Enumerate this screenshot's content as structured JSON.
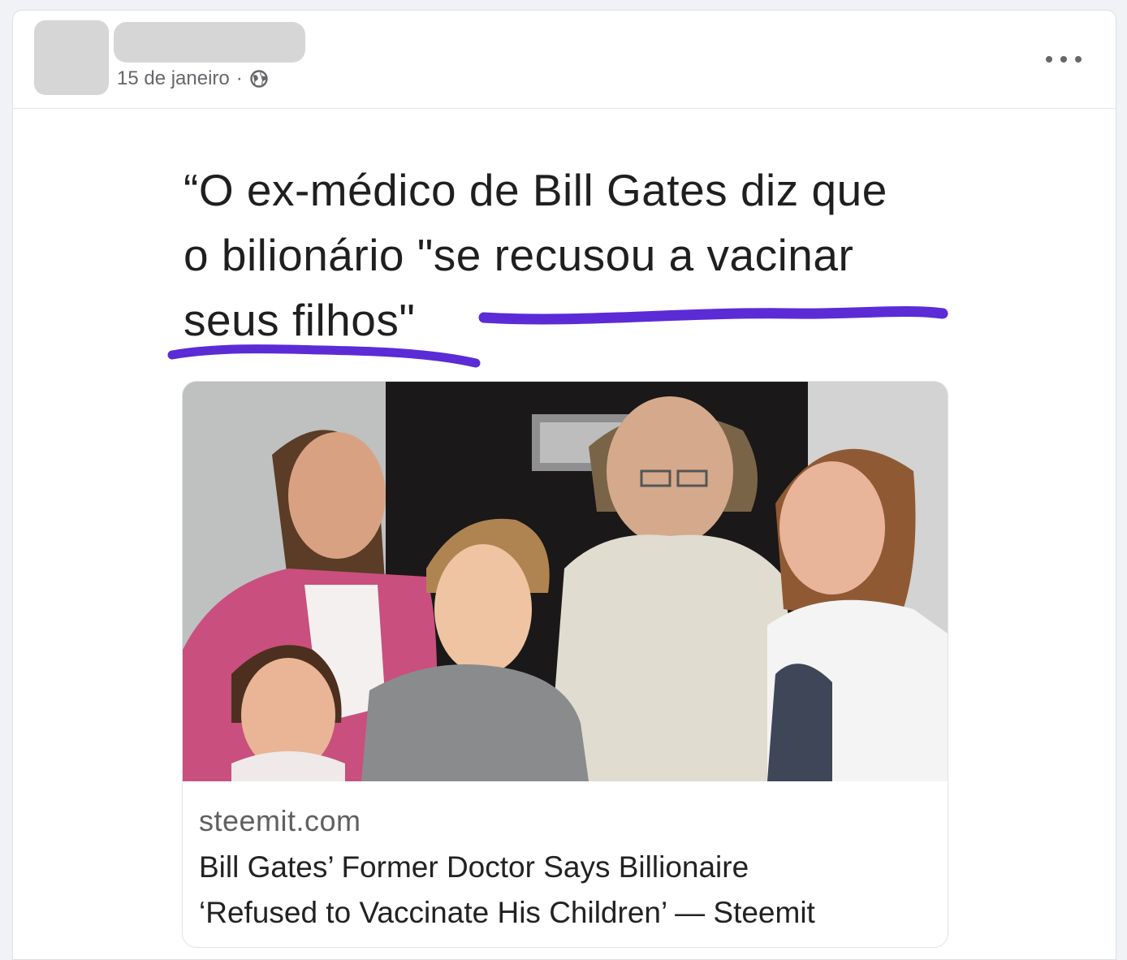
{
  "post": {
    "timestamp": "15 de janeiro",
    "separator": "·",
    "privacy_icon": "globe-icon",
    "menu_icon": "more-options-icon"
  },
  "content": {
    "quote_lines": [
      "“O ex-médico de Bill Gates diz que",
      "o bilionário \"se recusou a vacinar",
      "seus filhos\""
    ],
    "underline_color": "#5b2bd6"
  },
  "link_card": {
    "domain": "steemit.com",
    "headline_lines": [
      "Bill Gates’ Former Doctor Says Billionaire",
      "‘Refused to Vaccinate His Children’ — Steemit"
    ],
    "image": "family-photo"
  }
}
